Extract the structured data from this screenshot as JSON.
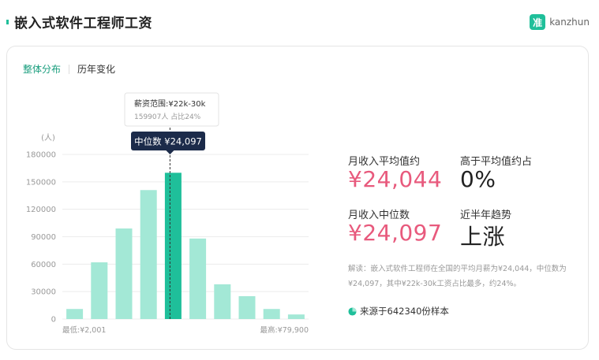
{
  "header": {
    "title": "嵌入式软件工程师工资",
    "brand_logo": "准",
    "brand_name": "kanzhun"
  },
  "tabs": [
    {
      "label": "整体分布",
      "active": true
    },
    {
      "label": "历年变化",
      "active": false
    }
  ],
  "chart_data": {
    "type": "bar",
    "ylabel": "(人)",
    "yticks": [
      0,
      30000,
      60000,
      90000,
      120000,
      150000,
      180000
    ],
    "ylim": [
      0,
      180000
    ],
    "values": [
      11000,
      62000,
      99000,
      141000,
      159907,
      88000,
      38000,
      25000,
      11000,
      5000
    ],
    "highlight_index": 4,
    "x_min_label": "最低:¥2,001",
    "x_max_label": "最高:¥79,900",
    "tooltip_title": "薪资范围:¥22k-30k",
    "tooltip_detail": "159907人   占比24%",
    "median_label": "中位数 ¥24,097",
    "colors": {
      "bar": "#a3e8d6",
      "highlight": "#1fbf9a",
      "grid": "#ececec",
      "axis_text": "#999999",
      "median_tag": "#1c2b4a"
    }
  },
  "stats": {
    "avg_label": "月收入平均值约",
    "avg_value": "¥24,044",
    "above_label": "高于平均值约占",
    "above_value": "0%",
    "median_label": "月收入中位数",
    "median_value": "¥24,097",
    "trend_label": "近半年趋势",
    "trend_value": "上涨"
  },
  "explain": "解读：嵌入式软件工程师在全国的平均月薪为¥24,044，中位数为¥24,097，其中¥22k-30k工资占比最多，约24%。",
  "source": {
    "icon": "pie-chart-icon",
    "text": "来源于642340份样本"
  }
}
